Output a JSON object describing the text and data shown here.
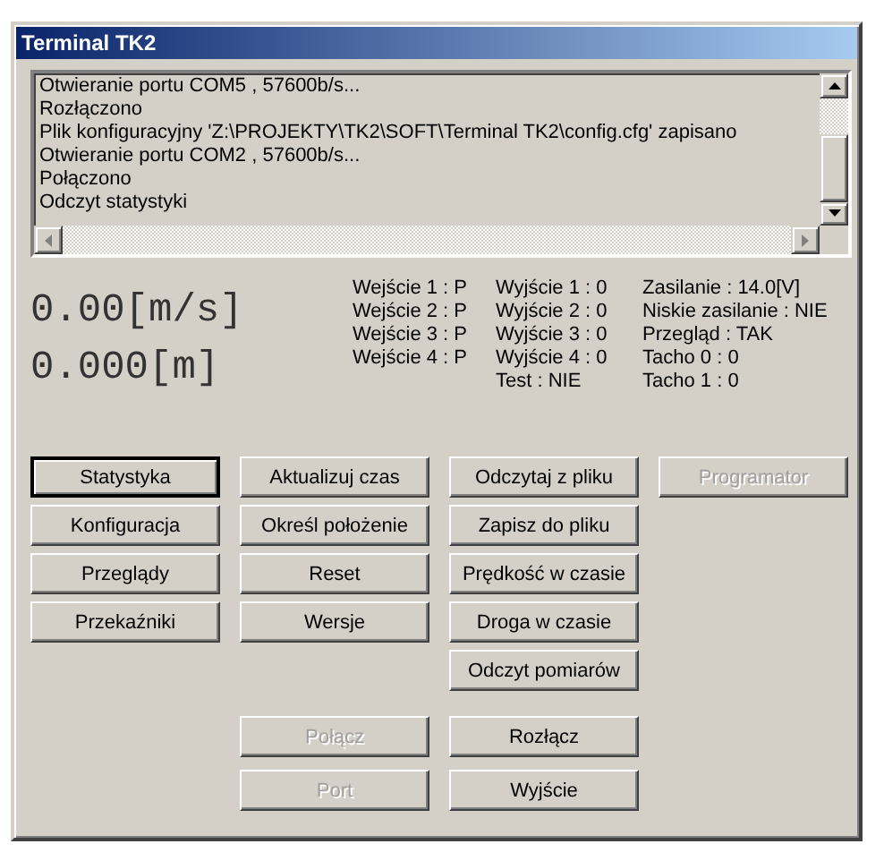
{
  "window": {
    "title": "Terminal TK2"
  },
  "log": {
    "lines": [
      "Otwieranie portu COM5 , 57600b/s...",
      "Rozłączono",
      "Plik konfiguracyjny 'Z:\\PROJEKTY\\TK2\\SOFT\\Terminal TK2\\config.cfg' zapisano",
      "Otwieranie portu COM2 , 57600b/s...",
      "Połączono",
      "Odczyt statystyki"
    ]
  },
  "readings": [
    "0.00[m/s]",
    "0.000[m]"
  ],
  "status_columns": [
    [
      "Wejście 1 : P",
      "Wejście 2 : P",
      "Wejście 3 : P",
      "Wejście 4 : P"
    ],
    [
      "Wyjście 1 : 0",
      "Wyjście 2 : 0",
      "Wyjście 3 : 0",
      "Wyjście 4 : 0",
      "Test : NIE"
    ],
    [
      "Zasilanie : 14.0[V]",
      "Niskie zasilanie : NIE",
      "Przegląd : TAK",
      "Tacho 0 : 0",
      "Tacho 1 : 0"
    ]
  ],
  "button_columns": [
    [
      {
        "label": "Statystyka",
        "default": true,
        "disabled": false
      },
      {
        "label": "Konfiguracja",
        "default": false,
        "disabled": false
      },
      {
        "label": "Przeglądy",
        "default": false,
        "disabled": false
      },
      {
        "label": "Przekaźniki",
        "default": false,
        "disabled": false
      }
    ],
    [
      {
        "label": "Aktualizuj czas",
        "default": false,
        "disabled": false
      },
      {
        "label": "Określ położenie",
        "default": false,
        "disabled": false
      },
      {
        "label": "Reset",
        "default": false,
        "disabled": false
      },
      {
        "label": "Wersje",
        "default": false,
        "disabled": false
      }
    ],
    [
      {
        "label": "Odczytaj z pliku",
        "default": false,
        "disabled": false
      },
      {
        "label": "Zapisz do pliku",
        "default": false,
        "disabled": false
      },
      {
        "label": "Prędkość w czasie",
        "default": false,
        "disabled": false
      },
      {
        "label": "Droga w czasie",
        "default": false,
        "disabled": false
      },
      {
        "label": "Odczyt pomiarów",
        "default": false,
        "disabled": false
      }
    ],
    [
      {
        "label": "Programator",
        "default": false,
        "disabled": true
      }
    ]
  ],
  "connection_buttons": [
    [
      {
        "label": "Połącz",
        "default": false,
        "disabled": true
      },
      {
        "label": "Rozłącz",
        "default": false,
        "disabled": false
      }
    ],
    [
      {
        "label": "Port",
        "default": false,
        "disabled": true
      },
      {
        "label": "Wyjście",
        "default": false,
        "disabled": false
      }
    ]
  ]
}
